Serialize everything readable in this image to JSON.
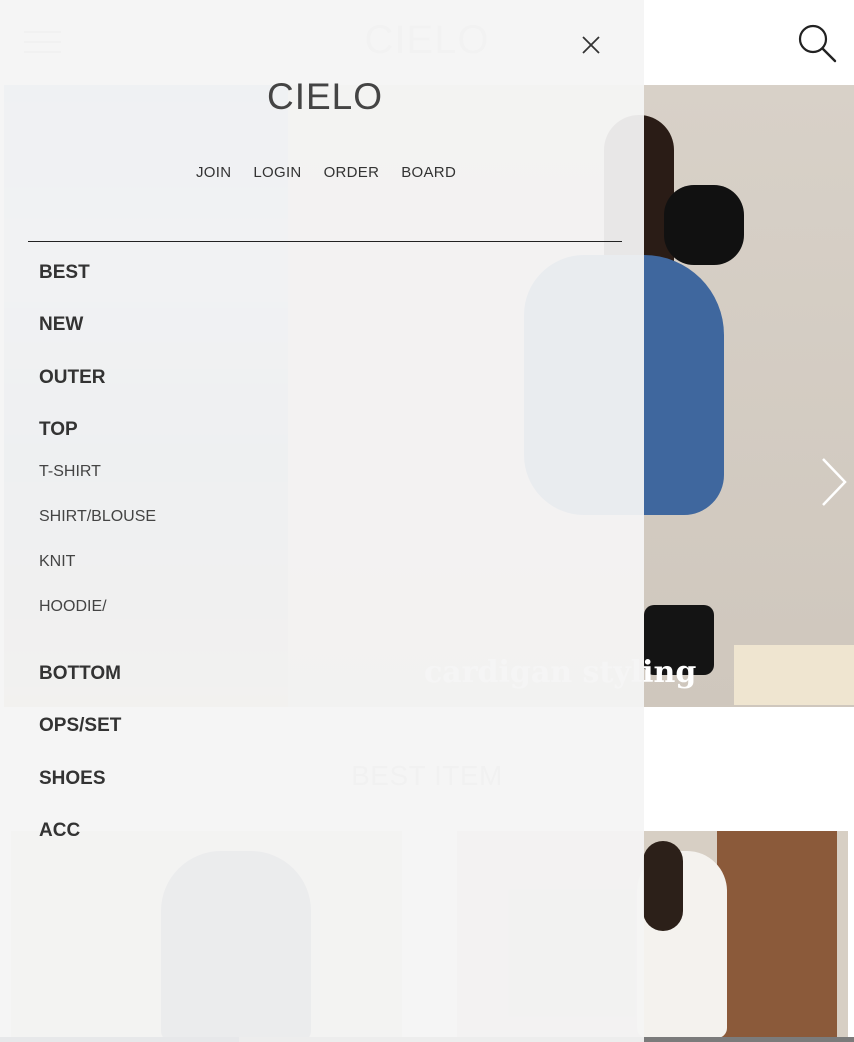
{
  "header": {
    "logo": "CIELO"
  },
  "hero": {
    "caption": "cardigan styling"
  },
  "best": {
    "title": "BEST ITEM",
    "progress": 0.28
  },
  "drawer": {
    "logo": "CIELO",
    "quick_links": [
      "JOIN",
      "LOGIN",
      "ORDER",
      "BOARD"
    ],
    "categories": [
      "BEST",
      "NEW",
      "OUTER",
      "TOP"
    ],
    "top_sub": [
      "T-SHIRT",
      "SHIRT/BLOUSE",
      "KNIT",
      "HOODIE/"
    ],
    "more_categories": [
      "BOTTOM",
      "OPS/SET",
      "SHOES",
      "ACC"
    ]
  },
  "icons": {
    "menu": "hamburger-menu-icon",
    "search": "search-icon",
    "next": "chevron-right-icon",
    "close": "close-icon"
  }
}
